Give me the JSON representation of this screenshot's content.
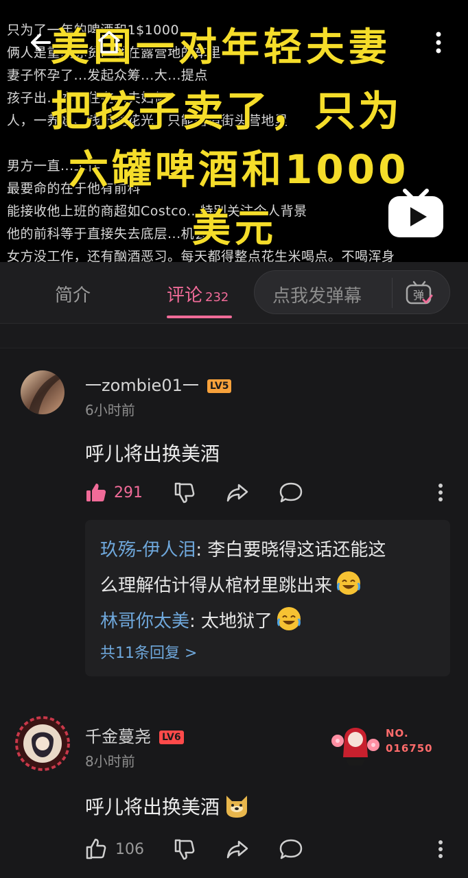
{
  "video": {
    "background_lines": [
      "只为了一年的啤酒和1$1000",
      "俩人是重度赤贫...睡在露营地的车里",
      "妻子怀孕了...发起众筹...大...提点",
      "孩子出...本...住在...夫妇俩",
      "人，一养娃、钱迅速花光，只能露宿街头营地里",
      "",
      "男方一直...工作",
      "最要命的在于他有前科",
      "能接收他上班的商超如Costco...特别关注个人背景",
      "他的前科等于直接失去底层...机会",
      "女方没工作，还有酗酒恶习。每天都得整点花生米喝点。不喝浑身"
    ],
    "caption_lines": [
      "美国一对年轻夫妻",
      "把孩子卖了，只为",
      "六罐啤酒和1000",
      "美元"
    ],
    "icons": {
      "back": "back-arrow-icon",
      "home": "home-icon",
      "more": "more-vertical-icon",
      "play": "play-tv-icon"
    }
  },
  "tabs": {
    "intro_label": "简介",
    "comments_label": "评论",
    "comments_count": "232",
    "danmaku_placeholder": "点我发弹幕",
    "danmaku_icon_label": "弹"
  },
  "colors": {
    "accent": "#f06b98",
    "reply_name": "#6fa8dc",
    "lv5": "#f7a13b",
    "lv6": "#ff4a4a"
  },
  "comments": [
    {
      "username": "一zombie01一",
      "level": "LV5",
      "time": "6小时前",
      "text": "呼儿将出换美酒",
      "likes": "291",
      "liked": true,
      "replies": [
        {
          "name": "玖殇-伊人泪",
          "text": ": 李白要晓得这话还能这",
          "text2": "么理解估计得从棺材里跳出来"
        },
        {
          "name": "林哥你太美",
          "text": ": 太地狱了"
        }
      ],
      "more_replies": "共11条回复 >"
    },
    {
      "username": "千金蔓尧",
      "level": "LV6",
      "time": "8小时前",
      "text": "呼儿将出换美酒",
      "likes": "106",
      "liked": false,
      "fan_badge_no": "NO.",
      "fan_badge_number": "016750"
    }
  ]
}
